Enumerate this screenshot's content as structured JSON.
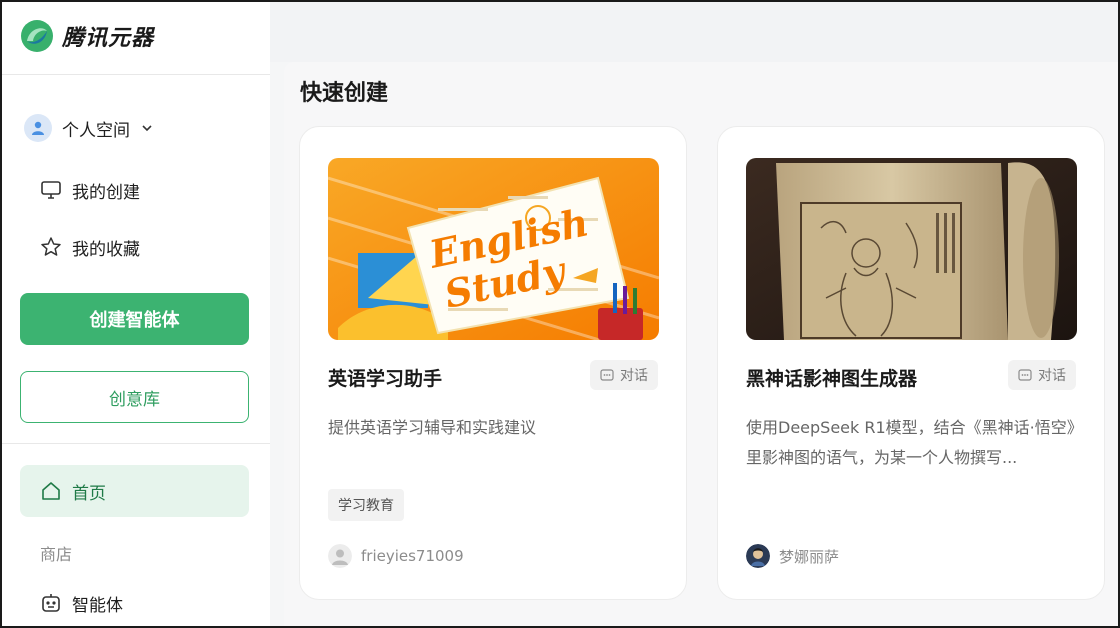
{
  "brand": {
    "name": "腾讯元器",
    "icon": "yuanqi-logo-icon"
  },
  "sidebar": {
    "space_label": "个人空间",
    "nav": [
      {
        "label": "我的创建",
        "icon": "monitor-icon"
      },
      {
        "label": "我的收藏",
        "icon": "star-icon"
      }
    ],
    "create_agent_label": "创建智能体",
    "idea_library_label": "创意库",
    "home_label": "首页",
    "store_section": "商店",
    "agents_label": "智能体"
  },
  "main": {
    "section_title": "快速创建",
    "cards": [
      {
        "image_text": [
          "English",
          "Study"
        ],
        "title": "英语学习助手",
        "chat_label": "对话",
        "description": "提供英语学习辅导和实践建议",
        "tag": "学习教育",
        "author": "frieyies71009"
      },
      {
        "title": "黑神话影神图生成器",
        "chat_label": "对话",
        "description": "使用DeepSeek R1模型，结合《黑神话·悟空》里影神图的语气，为某一个人物撰写...",
        "author": "梦娜丽萨"
      }
    ]
  },
  "colors": {
    "accent": "#3cb371",
    "accent_light": "#e6f4ec",
    "accent_text": "#1f7a47"
  }
}
